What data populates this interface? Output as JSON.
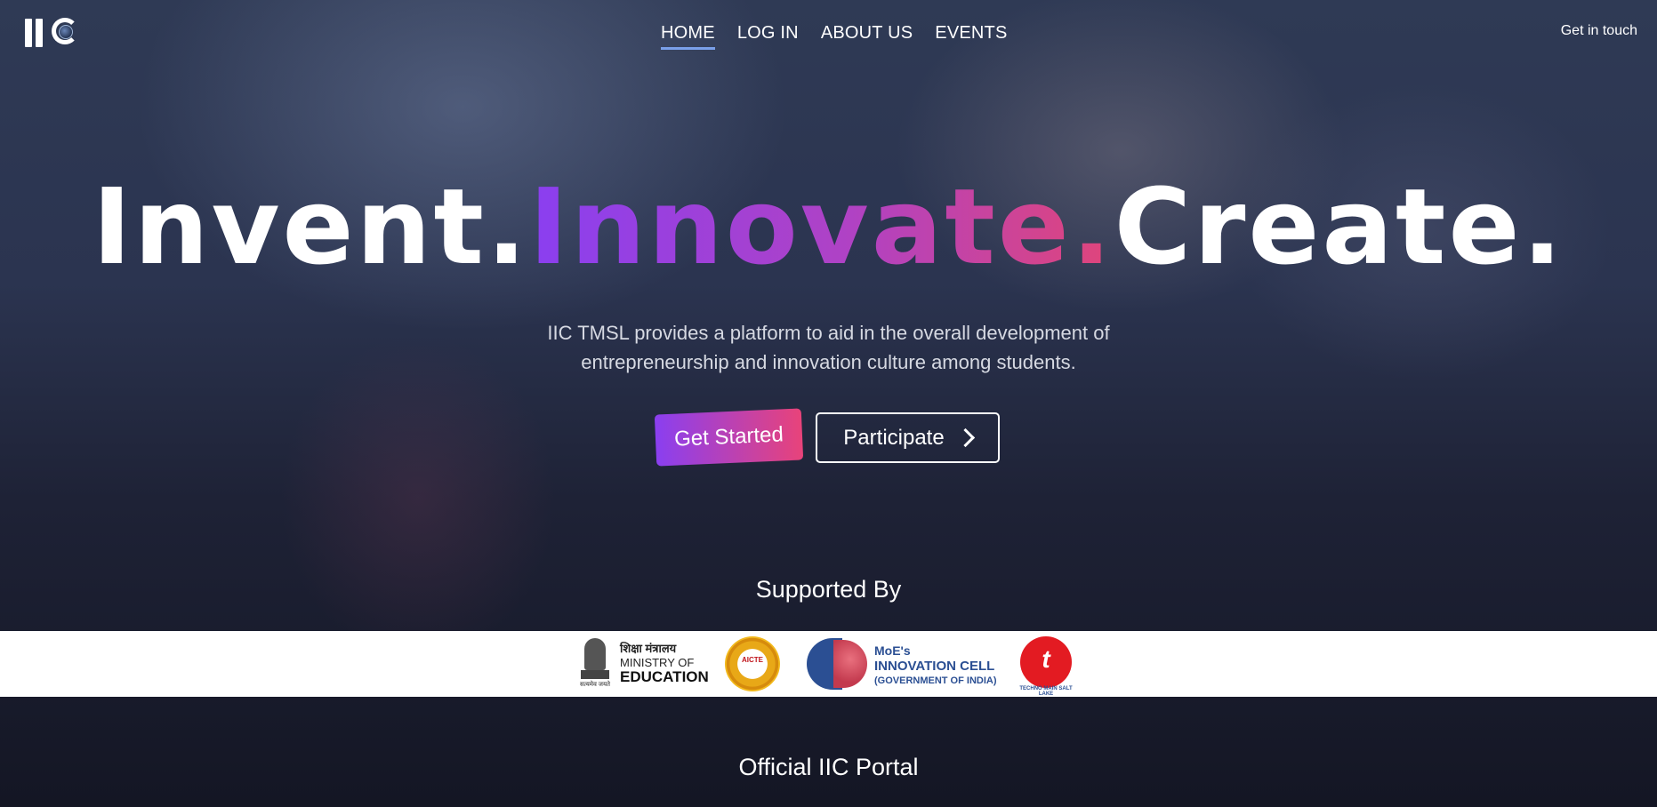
{
  "header": {
    "logo_text": "IIC",
    "nav": [
      {
        "label": "HOME",
        "active": true
      },
      {
        "label": "LOG IN",
        "active": false
      },
      {
        "label": "ABOUT US",
        "active": false
      },
      {
        "label": "EVENTS",
        "active": false
      }
    ],
    "cta_label": "Get in touch"
  },
  "hero": {
    "title_part1": "Invent.",
    "title_part2": "Innovate.",
    "title_part3": "Create.",
    "subtitle_line1": "IIC TMSL provides a platform to aid in the overall development of",
    "subtitle_line2": "entrepreneurship and innovation culture among students.",
    "primary_button": "Get Started",
    "secondary_button": "Participate"
  },
  "supported": {
    "heading": "Supported By",
    "sponsors": {
      "moe_hindi": "शिक्षा मंत्रालय",
      "moe_line1": "MINISTRY OF",
      "moe_line2": "EDUCATION",
      "moe_motto": "सत्यमेव जयते",
      "aicte_label": "AICTE",
      "mic_line1": "MoE's",
      "mic_line2": "INNOVATION CELL",
      "mic_line3": "(GOVERNMENT OF INDIA)",
      "tmsl_ring": "TECHNO MAIN SALT LAKE"
    }
  },
  "portal": {
    "heading": "Official IIC Portal"
  },
  "colors": {
    "accent_start": "#8a3ff0",
    "accent_end": "#e8437a",
    "nav_underline": "#7aa0ea"
  },
  "icons": [
    "iic-logo",
    "chevron-right-icon"
  ]
}
